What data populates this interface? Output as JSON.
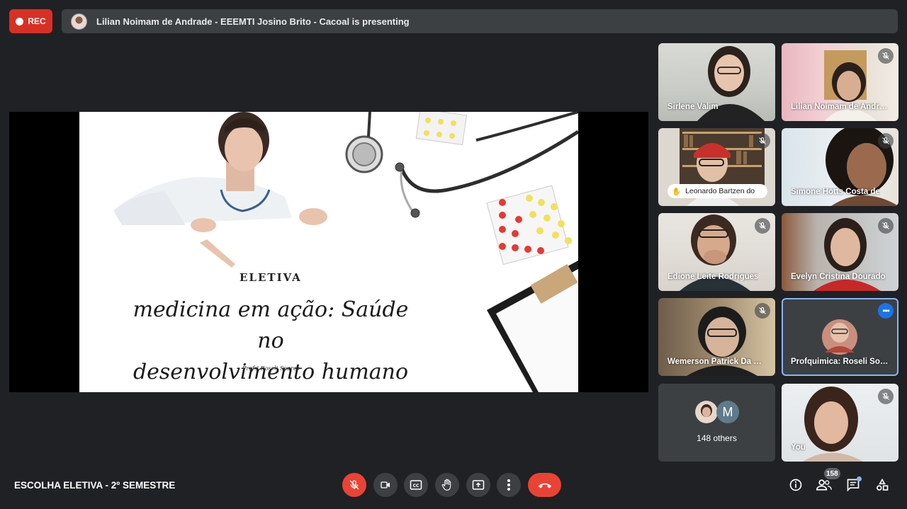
{
  "recording": {
    "label": "REC"
  },
  "presenting_bar": {
    "text": "Lilian Noimam de Andrade - EEEMTI Josino Brito - Cacoal is presenting"
  },
  "slide": {
    "heading": "ELETIVA",
    "title_line1": "medicina em ação: Saúde no",
    "title_line2": "desenvolvimento humano",
    "author": "Prof.ª Roseli Soares"
  },
  "participants": [
    {
      "name": "Sirlene Valim",
      "muted": false
    },
    {
      "name": "Lilian Noimam de Andrade - EEEMTI Josino Brito - Cacoal",
      "muted": true
    },
    {
      "name": "Leonardo Bartzen do",
      "muted": true,
      "hand_raised": true
    },
    {
      "name": "Simone Hotts Costa de",
      "muted": true
    },
    {
      "name": "Edione Leite Rodrigues",
      "muted": true
    },
    {
      "name": "Evelyn Cristina Dourado",
      "muted": true
    },
    {
      "name": "Wemerson Patrick Da Silva",
      "muted": true
    },
    {
      "name": "Profquimica: Roseli Soares",
      "muted": false,
      "pinned_menu": true
    },
    {
      "name": "You",
      "muted": true
    }
  ],
  "others": {
    "label": "148 others",
    "avatar_letter": "M"
  },
  "meeting": {
    "title": "ESCOLHA ELETIVA - 2º SEMESTRE"
  },
  "controls": {
    "mic": "mic-off-icon",
    "camera": "camera-icon",
    "captions": "captions-icon",
    "raise_hand": "hand-icon",
    "present": "present-icon",
    "more": "more-vert-icon",
    "leave": "phone-end-icon"
  },
  "right_controls": {
    "people_count": "158"
  },
  "colors": {
    "background": "#202124",
    "rec": "#d93025",
    "leave": "#ea4335",
    "accent": "#8ab4f8",
    "surface": "#3c4043"
  }
}
